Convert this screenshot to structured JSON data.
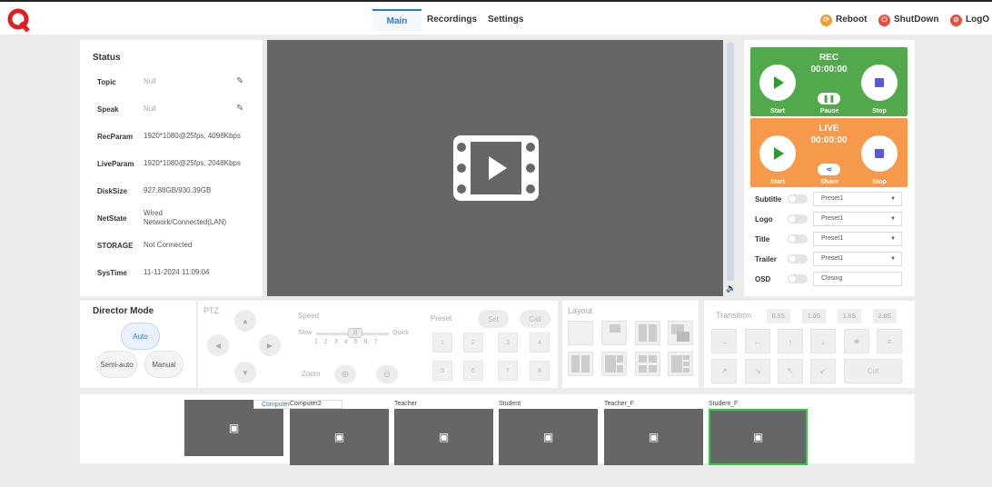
{
  "nav": {
    "tabs": [
      {
        "label": "Main"
      },
      {
        "label": "Recordings"
      },
      {
        "label": "Settings"
      }
    ],
    "reboot": "Reboot",
    "shutdown": "ShutDown",
    "logout": "LogO"
  },
  "status": {
    "title": "Status",
    "rows": [
      {
        "key": "Topic",
        "value": "Null"
      },
      {
        "key": "Speak",
        "value": "Null"
      },
      {
        "key": "RecParam",
        "value": "1920*1080@25fps, 4096Kbps"
      },
      {
        "key": "LiveParam",
        "value": "1920*1080@25fps, 2048Kbps"
      },
      {
        "key": "DiskSize",
        "value": "927.88GB/930.39GB"
      },
      {
        "key": "NetState",
        "value": "Wired",
        "value2": "Network/Connected(LAN)"
      },
      {
        "key": "STORAGE",
        "value": "Not Connected"
      },
      {
        "key": "SysTime",
        "value": "11-11-2024 11:09:04"
      }
    ]
  },
  "rec": {
    "title": "REC",
    "time": "00:00:00",
    "start": "Start",
    "pause": "Pause",
    "stop": "Stop"
  },
  "live": {
    "title": "LIVE",
    "time": "00:00:00",
    "start": "Start",
    "share": "Share",
    "stop": "Stop"
  },
  "options": [
    {
      "label": "Subtitle",
      "value": "Preset1"
    },
    {
      "label": "Logo",
      "value": "Preset1"
    },
    {
      "label": "Title",
      "value": "Preset1"
    },
    {
      "label": "Trailer",
      "value": "Preset1"
    },
    {
      "label": "OSD",
      "value": "Closing"
    }
  ],
  "director": {
    "title": "Director Mode",
    "auto": "Auto",
    "semi": "Semi-auto",
    "manual": "Manual"
  },
  "ptz": {
    "title": "PTZ",
    "speed": "Speed",
    "slow": "Slow",
    "quick": "Quick",
    "nums": [
      "1",
      "2",
      "3",
      "4",
      "5",
      "6",
      "7"
    ],
    "zoom": "Zoom",
    "preset": "Preset",
    "set": "Set",
    "call": "Call",
    "presets": [
      "1",
      "2",
      "3",
      "4",
      "5",
      "6",
      "7",
      "8"
    ]
  },
  "layout": {
    "title": "Layout"
  },
  "transition": {
    "title": "Transition",
    "speeds": [
      "0.5S",
      "1.0S",
      "1.5S",
      "2.0S"
    ],
    "cut": "Cut"
  },
  "sources": [
    {
      "name": "Computer"
    },
    {
      "name": "Computer2"
    },
    {
      "name": "Teacher"
    },
    {
      "name": "Student"
    },
    {
      "name": "Teacher_F"
    },
    {
      "name": "Student_F"
    }
  ],
  "colors": {
    "rec": "#52a94b",
    "live": "#f7994a",
    "accent": "#2a7ad6",
    "active_source": "#2ecc40"
  }
}
